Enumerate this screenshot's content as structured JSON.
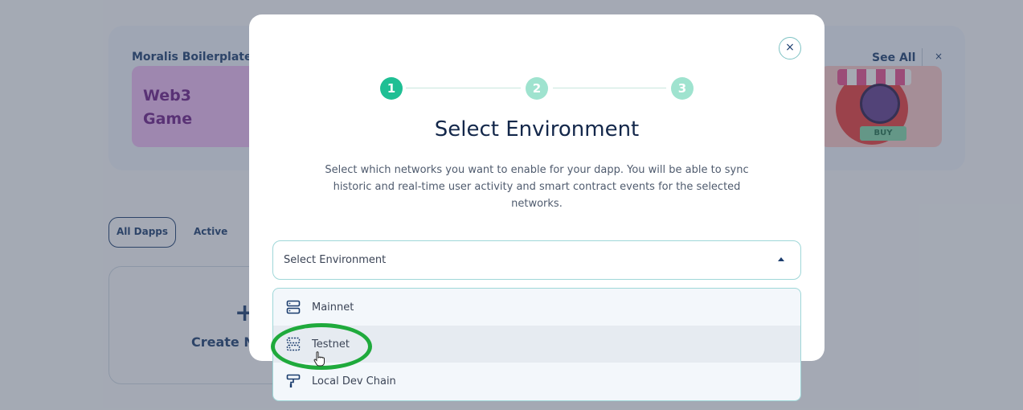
{
  "background": {
    "boilerplates_title": "Moralis Boilerplates",
    "web3_card_lines": [
      "Web3",
      "Game"
    ],
    "see_all": "See All",
    "close_glyph": "×",
    "promo_buy": "BUY",
    "filters": [
      "All Dapps",
      "Active"
    ],
    "create_plus": "+",
    "create_label": "Create Ne"
  },
  "modal": {
    "close_glyph": "×",
    "steps": [
      "1",
      "2",
      "3"
    ],
    "current_step": 1,
    "title": "Select Environment",
    "description": "Select which networks you want to enable for your dapp. You will be able to sync historic and real-time user activity and smart contract events for the selected networks.",
    "select": {
      "label": "Select Environment",
      "open": true
    },
    "options": [
      {
        "label": "Mainnet",
        "icon": "server-icon"
      },
      {
        "label": "Testnet",
        "icon": "server-dashed-icon",
        "hovered": true
      },
      {
        "label": "Local Dev Chain",
        "icon": "paint-roller-icon"
      }
    ]
  },
  "colors": {
    "accent": "#1fbf94",
    "accent_light": "#9fe3cf",
    "navy": "#1b3d6e",
    "highlight_ring": "#1faa3c"
  }
}
